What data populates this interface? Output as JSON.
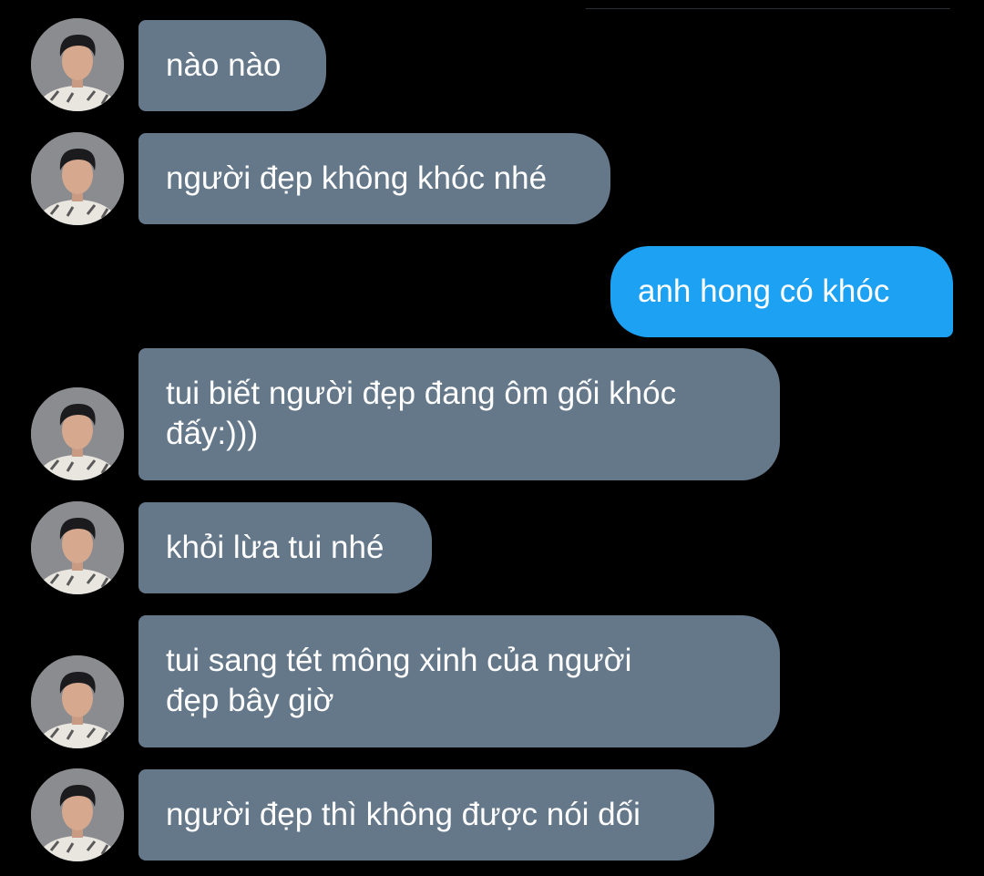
{
  "conversation": {
    "contact_avatar": "avatar-photo",
    "colors": {
      "background": "#000000",
      "incoming_bubble": "#65788a",
      "outgoing_bubble": "#1da1f2",
      "text": "#ffffff"
    },
    "messages": [
      {
        "direction": "incoming",
        "text": "nào nào"
      },
      {
        "direction": "incoming",
        "text": "người đẹp không khóc nhé"
      },
      {
        "direction": "outgoing",
        "text": "anh hong có khóc"
      },
      {
        "direction": "incoming",
        "text": "tui biết người đẹp đang ôm gối khóc\nđấy:)))"
      },
      {
        "direction": "incoming",
        "text": "khỏi lừa tui nhé"
      },
      {
        "direction": "incoming",
        "text": "tui sang tét mông xinh của người\nđẹp bây giờ"
      },
      {
        "direction": "incoming",
        "text": "người đẹp thì không được nói dối"
      }
    ]
  }
}
